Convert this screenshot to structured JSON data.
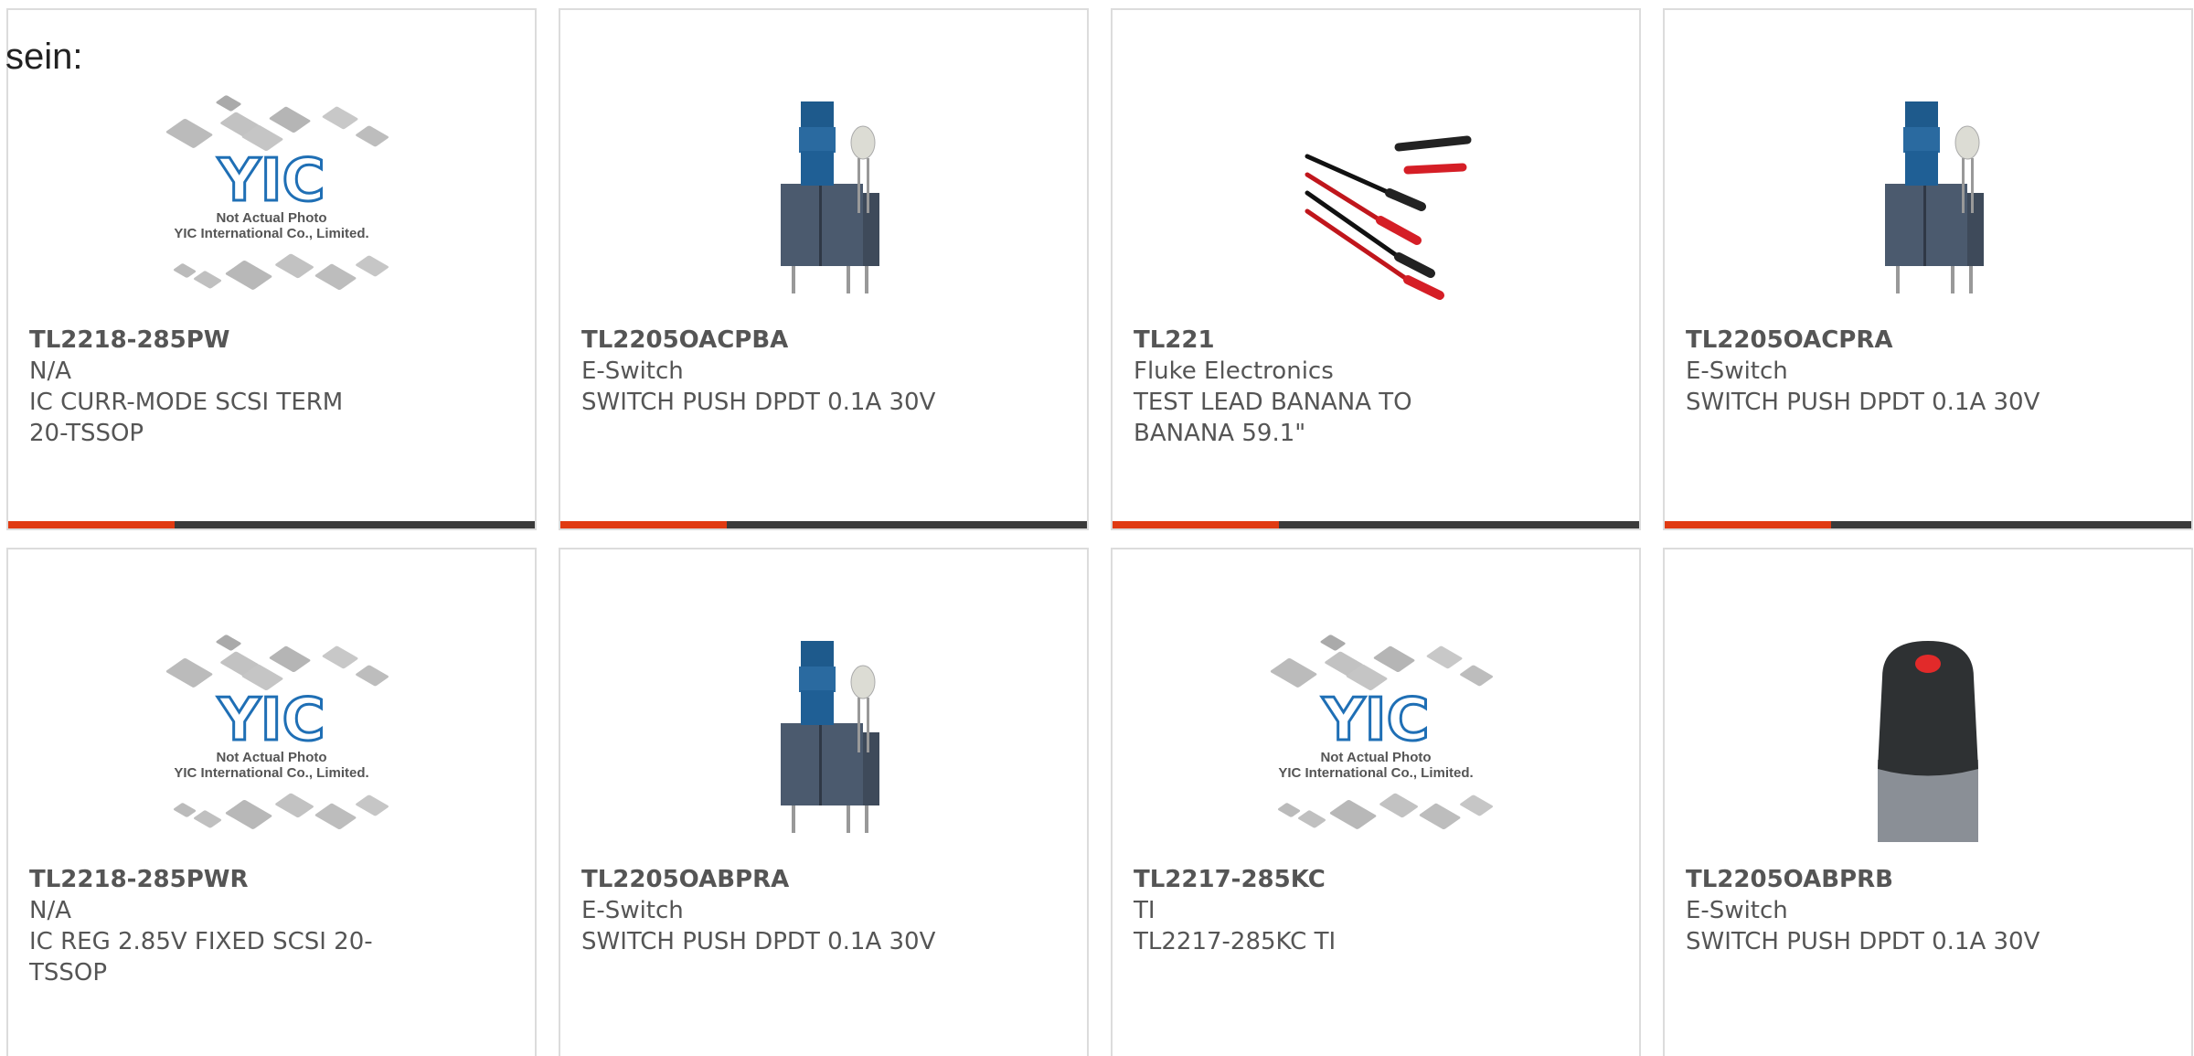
{
  "intro_text": "sein:",
  "colors": {
    "accent": "#e03a12",
    "bar": "#3a3a3a",
    "text": "#555555",
    "yic_blue": "#1f6fb5"
  },
  "placeholder_caption": [
    "Not Actual Photo",
    "YIC International Co., Limited."
  ],
  "placeholder_logo": "YIC",
  "products": [
    {
      "part": "TL2218-285PW",
      "maker": "N/A",
      "desc": "IC CURR-MODE SCSI TERM 20-TSSOP",
      "image": "yic-placeholder-icon"
    },
    {
      "part": "TL2205OACPBA",
      "maker": "E-Switch",
      "desc": "SWITCH PUSH DPDT 0.1A 30V",
      "image": "push-switch-icon"
    },
    {
      "part": "TL221",
      "maker": "Fluke Electronics",
      "desc": "TEST LEAD BANANA TO BANANA 59.1\"",
      "image": "test-lead-icon"
    },
    {
      "part": "TL2205OACPRA",
      "maker": "E-Switch",
      "desc": "SWITCH PUSH DPDT 0.1A 30V",
      "image": "push-switch-icon"
    },
    {
      "part": "TL2218-285PWR",
      "maker": "N/A",
      "desc": "IC REG 2.85V FIXED SCSI 20-TSSOP",
      "image": "yic-placeholder-icon"
    },
    {
      "part": "TL2205OABPRA",
      "maker": "E-Switch",
      "desc": "SWITCH PUSH DPDT 0.1A 30V",
      "image": "push-switch-icon"
    },
    {
      "part": "TL2217-285KC",
      "maker": "TI",
      "desc": "TL2217-285KC TI",
      "image": "yic-placeholder-icon"
    },
    {
      "part": "TL2205OABPRB",
      "maker": "E-Switch",
      "desc": "SWITCH PUSH DPDT 0.1A 30V",
      "image": "led-push-switch-icon"
    }
  ]
}
